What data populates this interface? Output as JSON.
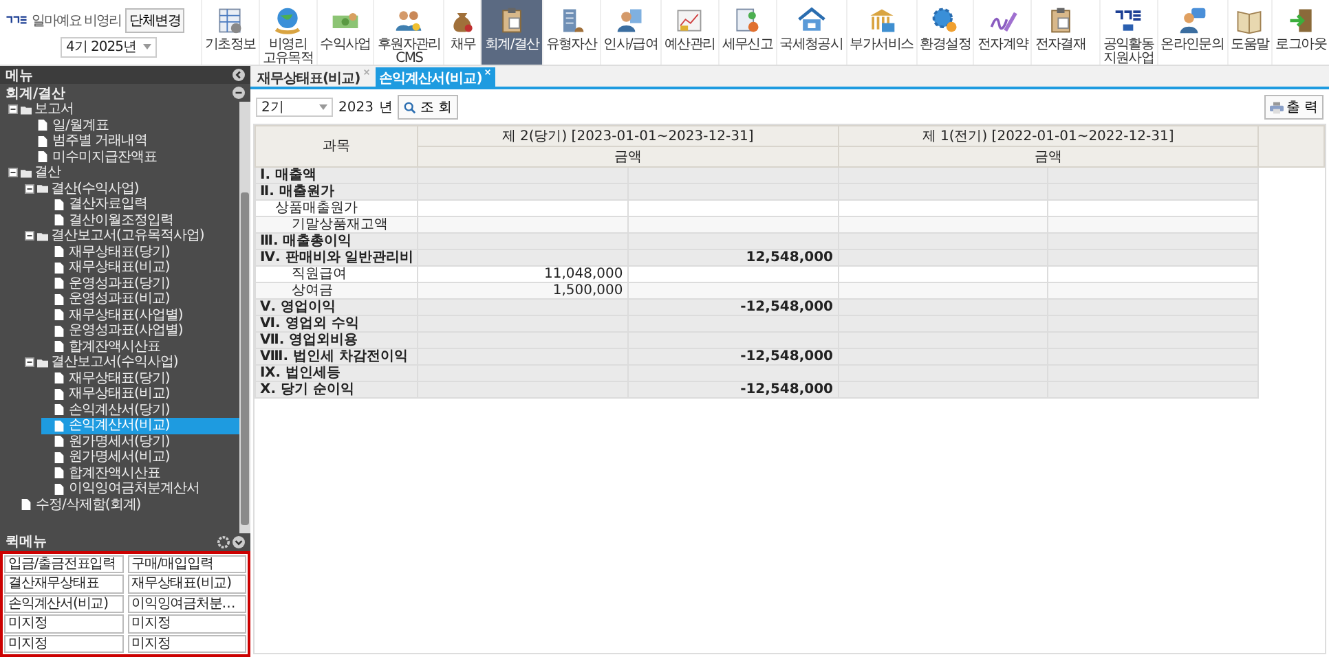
{
  "header": {
    "brand": "일마예요 비영리",
    "org_button": "단체변경",
    "period_select": "4기 2025년"
  },
  "top_menu": [
    {
      "label": "기초정보",
      "selected": false
    },
    {
      "label": "비영리\n고유목적",
      "selected": false
    },
    {
      "label": "수익사업",
      "selected": false
    },
    {
      "label": "후원자관리\nCMS",
      "selected": false
    },
    {
      "label": "채무",
      "selected": false
    },
    {
      "label": "회계/결산",
      "selected": true
    },
    {
      "label": "유형자산",
      "selected": false
    },
    {
      "label": "인사/급여",
      "selected": false
    },
    {
      "label": "예산관리",
      "selected": false
    },
    {
      "label": "세무신고",
      "selected": false
    },
    {
      "label": "국세청공시",
      "selected": false
    },
    {
      "label": "부가서비스",
      "selected": false
    },
    {
      "label": "환경설정",
      "selected": false
    },
    {
      "label": "전자계약",
      "selected": false
    },
    {
      "label": "전자결재",
      "selected": false
    }
  ],
  "right_menu": [
    {
      "label": "공익활동\n지원사업"
    },
    {
      "label": "온라인문의"
    },
    {
      "label": "도움말"
    },
    {
      "label": "로그아웃"
    }
  ],
  "sidebar": {
    "title": "메뉴",
    "section": "회계/결산",
    "tree": [
      {
        "label": "보고서",
        "kind": "folder",
        "expanded": true,
        "children": [
          {
            "label": "일/월계표",
            "kind": "file",
            "selected": false
          },
          {
            "label": "범주별 거래내역",
            "kind": "file",
            "selected": false
          },
          {
            "label": "미수미지급잔액표",
            "kind": "file",
            "selected": false
          }
        ]
      },
      {
        "label": "결산",
        "kind": "folder",
        "expanded": true,
        "children": [
          {
            "label": "결산(수익사업)",
            "kind": "folder",
            "expanded": true,
            "children": [
              {
                "label": "결산자료입력",
                "kind": "file",
                "selected": false
              },
              {
                "label": "결산이월조정입력",
                "kind": "file",
                "selected": false
              }
            ]
          },
          {
            "label": "결산보고서(고유목적사업)",
            "kind": "folder",
            "expanded": true,
            "children": [
              {
                "label": "재무상태표(당기)",
                "kind": "file",
                "selected": false
              },
              {
                "label": "재무상태표(비교)",
                "kind": "file",
                "selected": false
              },
              {
                "label": "운영성과표(당기)",
                "kind": "file",
                "selected": false
              },
              {
                "label": "운영성과표(비교)",
                "kind": "file",
                "selected": false
              },
              {
                "label": "재무상태표(사업별)",
                "kind": "file",
                "selected": false
              },
              {
                "label": "운영성과표(사업별)",
                "kind": "file",
                "selected": false
              },
              {
                "label": "합계잔액시산표",
                "kind": "file",
                "selected": false
              }
            ]
          },
          {
            "label": "결산보고서(수익사업)",
            "kind": "folder",
            "expanded": true,
            "children": [
              {
                "label": "재무상태표(당기)",
                "kind": "file",
                "selected": false
              },
              {
                "label": "재무상태표(비교)",
                "kind": "file",
                "selected": false
              },
              {
                "label": "손익계산서(당기)",
                "kind": "file",
                "selected": false
              },
              {
                "label": "손익계산서(비교)",
                "kind": "file",
                "selected": true
              },
              {
                "label": "원가명세서(당기)",
                "kind": "file",
                "selected": false
              },
              {
                "label": "원가명세서(비교)",
                "kind": "file",
                "selected": false
              },
              {
                "label": "합계잔액시산표",
                "kind": "file",
                "selected": false
              },
              {
                "label": "이익잉여금처분계산서",
                "kind": "file",
                "selected": false
              }
            ]
          }
        ]
      },
      {
        "label": "수정/삭제함(회계)",
        "kind": "file",
        "selected": false
      }
    ],
    "quick_menu": {
      "title": "퀵메뉴",
      "items": [
        "입금/출금전표입력",
        "구매/매입입력",
        "결산재무상태표",
        "재무상태표(비교)",
        "손익계산서(비교)",
        "이익잉여금처분…",
        "미지정",
        "미지정",
        "미지정",
        "미지정"
      ]
    }
  },
  "tabs": [
    {
      "label": "재무상태표(비교)",
      "selected": false
    },
    {
      "label": "손익계산서(비교)",
      "selected": true
    }
  ],
  "toolbar": {
    "period_select": "2기",
    "year": "2023",
    "year_unit": "년",
    "search_button": "조 회",
    "print_button": "출 력"
  },
  "table": {
    "subject_heading": "과목",
    "current_heading": "제 2(당기) [2023-01-01~2023-12-31]",
    "prior_heading": "제 1(전기) [2022-01-01~2022-12-31]",
    "current_amount_heading": "금액",
    "prior_amount_heading": "금액",
    "rows": [
      {
        "kind": "group",
        "subject": "Ⅰ. 매출액"
      },
      {
        "kind": "group",
        "subject": "Ⅱ. 매출원가"
      },
      {
        "kind": "item",
        "subject": "상품매출원가"
      },
      {
        "kind": "subitem",
        "subject": "기말상품재고액"
      },
      {
        "kind": "group",
        "subject": "Ⅲ. 매출총이익"
      },
      {
        "kind": "group",
        "subject": "Ⅳ. 판매비와 일반관리비",
        "current_total": "12,548,000"
      },
      {
        "kind": "subitem",
        "subject": "직원급여",
        "current_detail": "11,048,000"
      },
      {
        "kind": "subitem",
        "subject": "상여금",
        "current_detail": "1,500,000"
      },
      {
        "kind": "group",
        "subject": "Ⅴ. 영업이익",
        "current_total": "-12,548,000"
      },
      {
        "kind": "group",
        "subject": "Ⅵ. 영업외 수익"
      },
      {
        "kind": "group",
        "subject": "Ⅶ. 영업외비용"
      },
      {
        "kind": "group",
        "subject": "Ⅷ. 법인세 차감전이익",
        "current_total": "-12,548,000"
      },
      {
        "kind": "group",
        "subject": "Ⅸ. 법인세등"
      },
      {
        "kind": "group",
        "subject": "Ⅹ. 당기 순이익",
        "current_total": "-12,548,000"
      }
    ]
  }
}
